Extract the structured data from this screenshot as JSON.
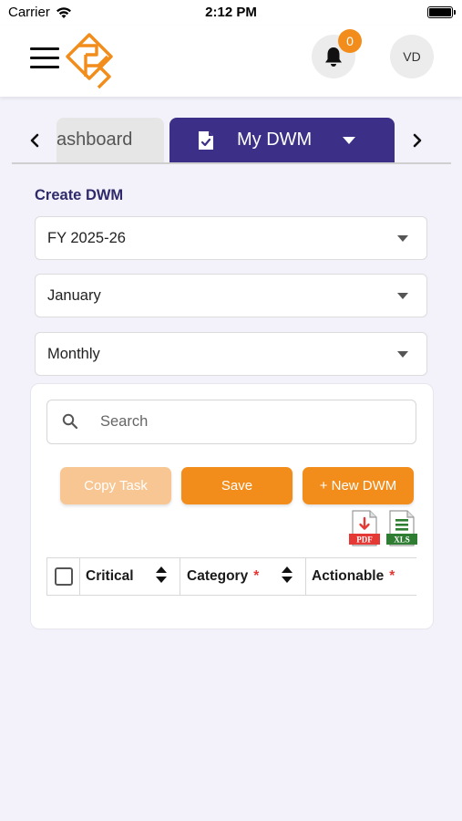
{
  "status_bar": {
    "carrier": "Carrier",
    "time": "2:12 PM"
  },
  "header": {
    "notification_count": "0",
    "avatar_initials": "VD",
    "brand_color": "#f28c1b"
  },
  "tabs": {
    "items": [
      {
        "label": "ashboard",
        "active": false
      },
      {
        "label": "My DWM",
        "active": true
      }
    ],
    "active_color": "#3b2f87"
  },
  "form": {
    "title": "Create DWM",
    "fiscal_year": "FY 2025-26",
    "month": "January",
    "frequency": "Monthly"
  },
  "search": {
    "placeholder": "Search"
  },
  "actions": {
    "copy_task": "Copy Task",
    "save": "Save",
    "new_dwm": "+ New DWM",
    "pdf_label": "PDF",
    "xls_label": "XLS"
  },
  "table": {
    "columns": [
      {
        "label": "Critical",
        "required": false
      },
      {
        "label": "Category",
        "required": true
      },
      {
        "label": "Actionable",
        "required": true
      }
    ],
    "required_mark": "*"
  }
}
